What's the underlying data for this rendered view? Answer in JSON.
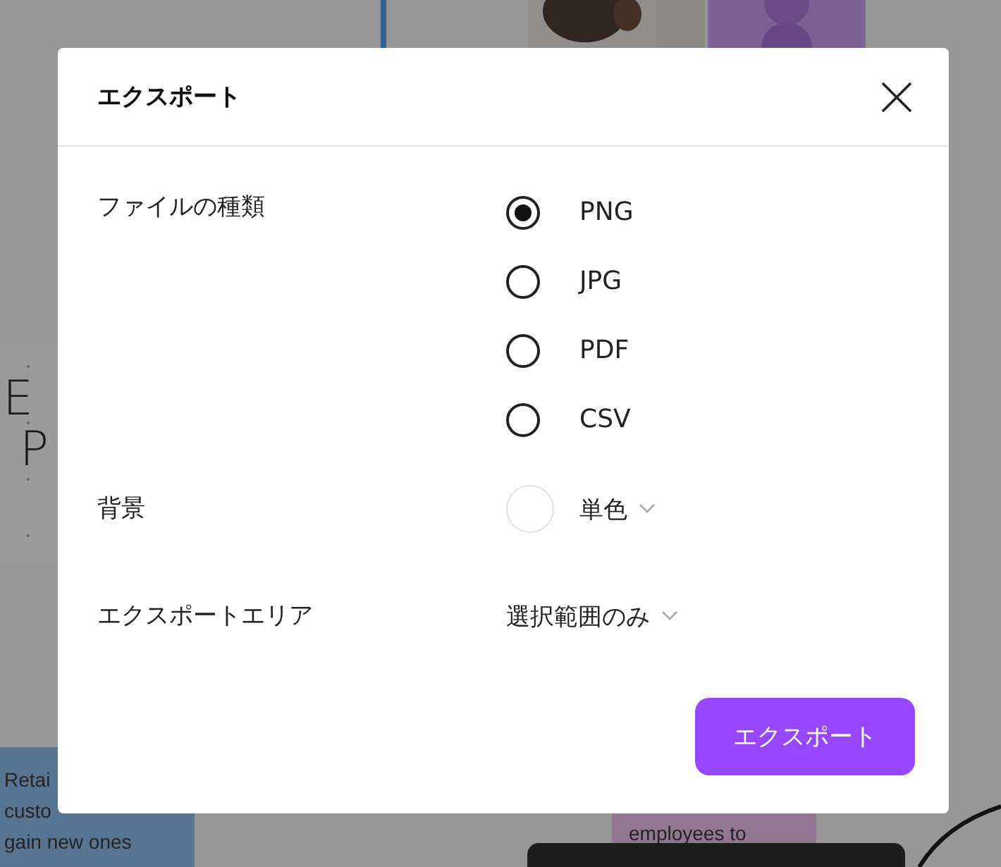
{
  "canvas": {
    "handwriting": [
      "E",
      "P"
    ],
    "notes": [
      {
        "kind": "blue",
        "lines": [
          "Retai",
          "custo",
          "gain new ones"
        ]
      },
      {
        "kind": "pink",
        "lines": [
          "employees to"
        ]
      }
    ]
  },
  "dialog": {
    "title": "エクスポート",
    "file_type": {
      "label": "ファイルの種類",
      "options": [
        {
          "label": "PNG",
          "selected": true
        },
        {
          "label": "JPG",
          "selected": false
        },
        {
          "label": "PDF",
          "selected": false
        },
        {
          "label": "CSV",
          "selected": false
        }
      ]
    },
    "background": {
      "label": "背景",
      "value": "単色",
      "color": "#ffffff"
    },
    "export_area": {
      "label": "エクスポートエリア",
      "value": "選択範囲のみ"
    },
    "button": "エクスポート"
  }
}
